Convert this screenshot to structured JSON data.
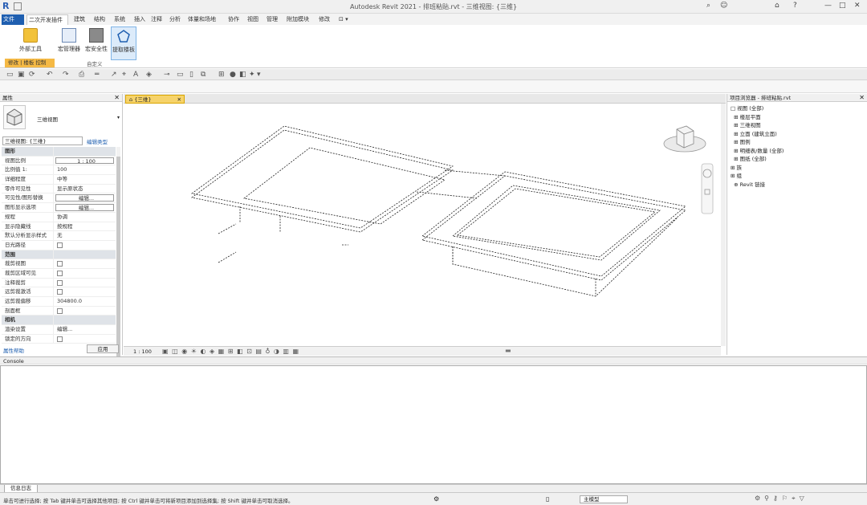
{
  "window": {
    "title": "Autodesk Revit 2021 - 排班粘贴.rvt - 三维视图: {三维}",
    "logo": "R",
    "controls": [
      "—",
      "□",
      "✕"
    ]
  },
  "ribbon": {
    "file_tab": "文件",
    "tabs": [
      "二次开发插件",
      "建筑",
      "结构",
      "系统",
      "插入",
      "注释",
      "分析",
      "体量和场地",
      "协作",
      "视图",
      "管理",
      "附加模块",
      "修改"
    ],
    "active_tab": "二次开发插件",
    "buttons": [
      "外部工具",
      "宏管理器",
      "宏安全性",
      "提取楼板"
    ],
    "panel_labels": [
      "修改 | 楼板 控制",
      "自定义"
    ]
  },
  "properties": {
    "header": "属性",
    "type_name": "三维视图",
    "view_selector": "三维视图: {三维}",
    "edit_type": "编辑类型",
    "rows": [
      {
        "k": "图形",
        "v": "",
        "group": true
      },
      {
        "k": "视图比例",
        "v": "1 : 100",
        "boxed": true
      },
      {
        "k": "比例值 1:",
        "v": "100"
      },
      {
        "k": "详细程度",
        "v": "中等"
      },
      {
        "k": "零件可见性",
        "v": "显示原状态"
      },
      {
        "k": "可见性/图形替换",
        "v": "编辑...",
        "boxed": true
      },
      {
        "k": "图形显示选项",
        "v": "编辑...",
        "boxed": true
      },
      {
        "k": "规程",
        "v": "协调"
      },
      {
        "k": "显示隐藏线",
        "v": "按规程"
      },
      {
        "k": "默认分析显示样式",
        "v": "无"
      },
      {
        "k": "日光路径",
        "v": "",
        "check": true
      },
      {
        "k": "范围",
        "v": "",
        "group": true
      },
      {
        "k": "裁剪视图",
        "v": "",
        "check": true
      },
      {
        "k": "裁剪区域可见",
        "v": "",
        "check": true
      },
      {
        "k": "注释裁剪",
        "v": "",
        "check": true
      },
      {
        "k": "远剪裁激活",
        "v": "",
        "check": true
      },
      {
        "k": "远剪裁偏移",
        "v": "304800.0"
      },
      {
        "k": "剖面框",
        "v": "",
        "check": true
      },
      {
        "k": "相机",
        "v": "",
        "group": true
      },
      {
        "k": "渲染设置",
        "v": "编辑..."
      },
      {
        "k": "锁定的方向",
        "v": "",
        "check": true
      }
    ],
    "help_link": "属性帮助",
    "apply": "应用"
  },
  "view": {
    "tab_label": "{三维}",
    "scale": "1 : 100"
  },
  "browser": {
    "header": "项目浏览器 - 排班粘贴.rvt",
    "items": [
      "□ 视图 (全部)",
      "  ⊞ 楼层平面",
      "  ⊞ 三维视图",
      "  ⊞ 立面 (建筑立面)",
      "  ⊞ 图例",
      "  ⊞ 明细表/数量 (全部)",
      "  ⊞ 图纸 (全部)",
      "⊞ 族",
      "⊞ 组",
      "  ⊕ Revit 链接"
    ]
  },
  "console": {
    "header": "Console",
    "tab": "信息日志"
  },
  "status": {
    "text": "单击可进行选择; 按 Tab 键并单击可选择其他项目; 按 Ctrl 键并单击可将新项目添加到选择集; 按 Shift 键并单击可取消选择。",
    "model": "主模型"
  }
}
